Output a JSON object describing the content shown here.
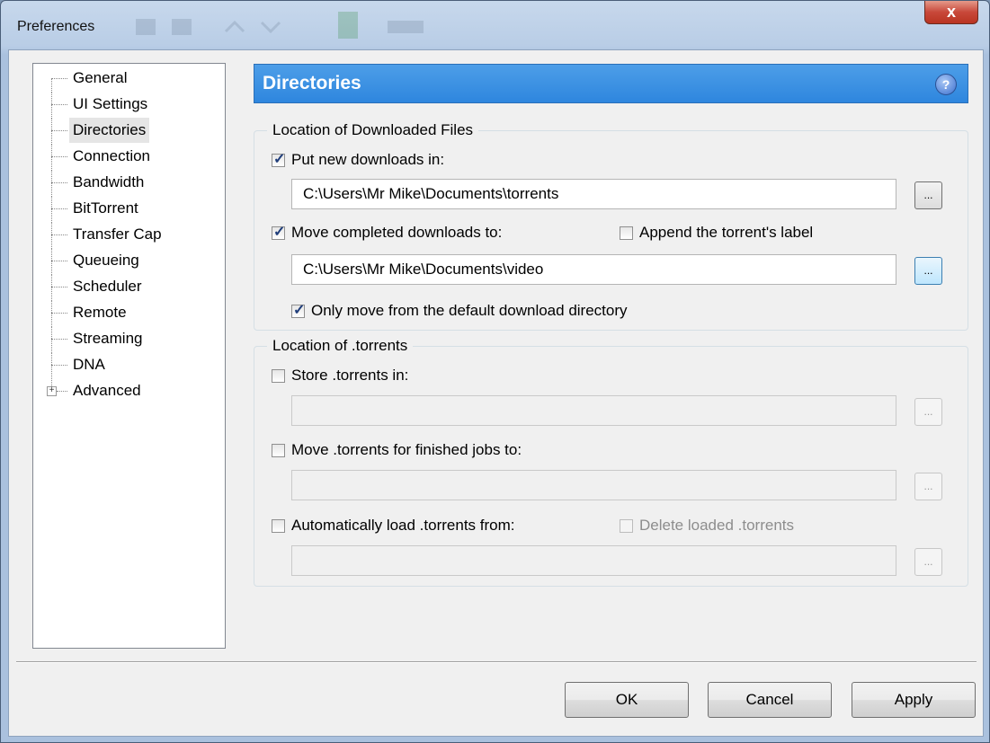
{
  "window": {
    "title": "Preferences",
    "close_label": "x"
  },
  "sidebar": {
    "items": [
      {
        "label": "General"
      },
      {
        "label": "UI Settings"
      },
      {
        "label": "Directories",
        "selected": true
      },
      {
        "label": "Connection"
      },
      {
        "label": "Bandwidth"
      },
      {
        "label": "BitTorrent"
      },
      {
        "label": "Transfer Cap"
      },
      {
        "label": "Queueing"
      },
      {
        "label": "Scheduler"
      },
      {
        "label": "Remote"
      },
      {
        "label": "Streaming"
      },
      {
        "label": "DNA"
      },
      {
        "label": "Advanced",
        "expandable": true,
        "expander": "+"
      }
    ]
  },
  "header": {
    "title": "Directories",
    "help_icon": "?"
  },
  "downloaded": {
    "group_title": "Location of Downloaded Files",
    "put_new": {
      "label": "Put new downloads in:",
      "checked": true,
      "path": "C:\\Users\\Mr Mike\\Documents\\torrents"
    },
    "move_completed": {
      "label": "Move completed downloads to:",
      "checked": true,
      "path": "C:\\Users\\Mr Mike\\Documents\\video"
    },
    "append_label": {
      "label": "Append the torrent's label",
      "checked": false
    },
    "only_move": {
      "label": "Only move from the default download directory",
      "checked": true
    },
    "browse_label": "..."
  },
  "torrents": {
    "group_title": "Location of .torrents",
    "store": {
      "label": "Store .torrents in:",
      "checked": false,
      "path": ""
    },
    "move_finished": {
      "label": "Move .torrents for finished jobs to:",
      "checked": false,
      "path": ""
    },
    "auto_load": {
      "label": "Automatically load .torrents from:",
      "checked": false,
      "path": ""
    },
    "delete_loaded": {
      "label": "Delete loaded .torrents",
      "checked": false,
      "disabled": true
    },
    "browse_label": "..."
  },
  "footer": {
    "ok": "OK",
    "cancel": "Cancel",
    "apply": "Apply"
  },
  "colors": {
    "header_blue": "#2e86de",
    "client_bg": "#f0f0f0",
    "close_red": "#c8483a"
  }
}
